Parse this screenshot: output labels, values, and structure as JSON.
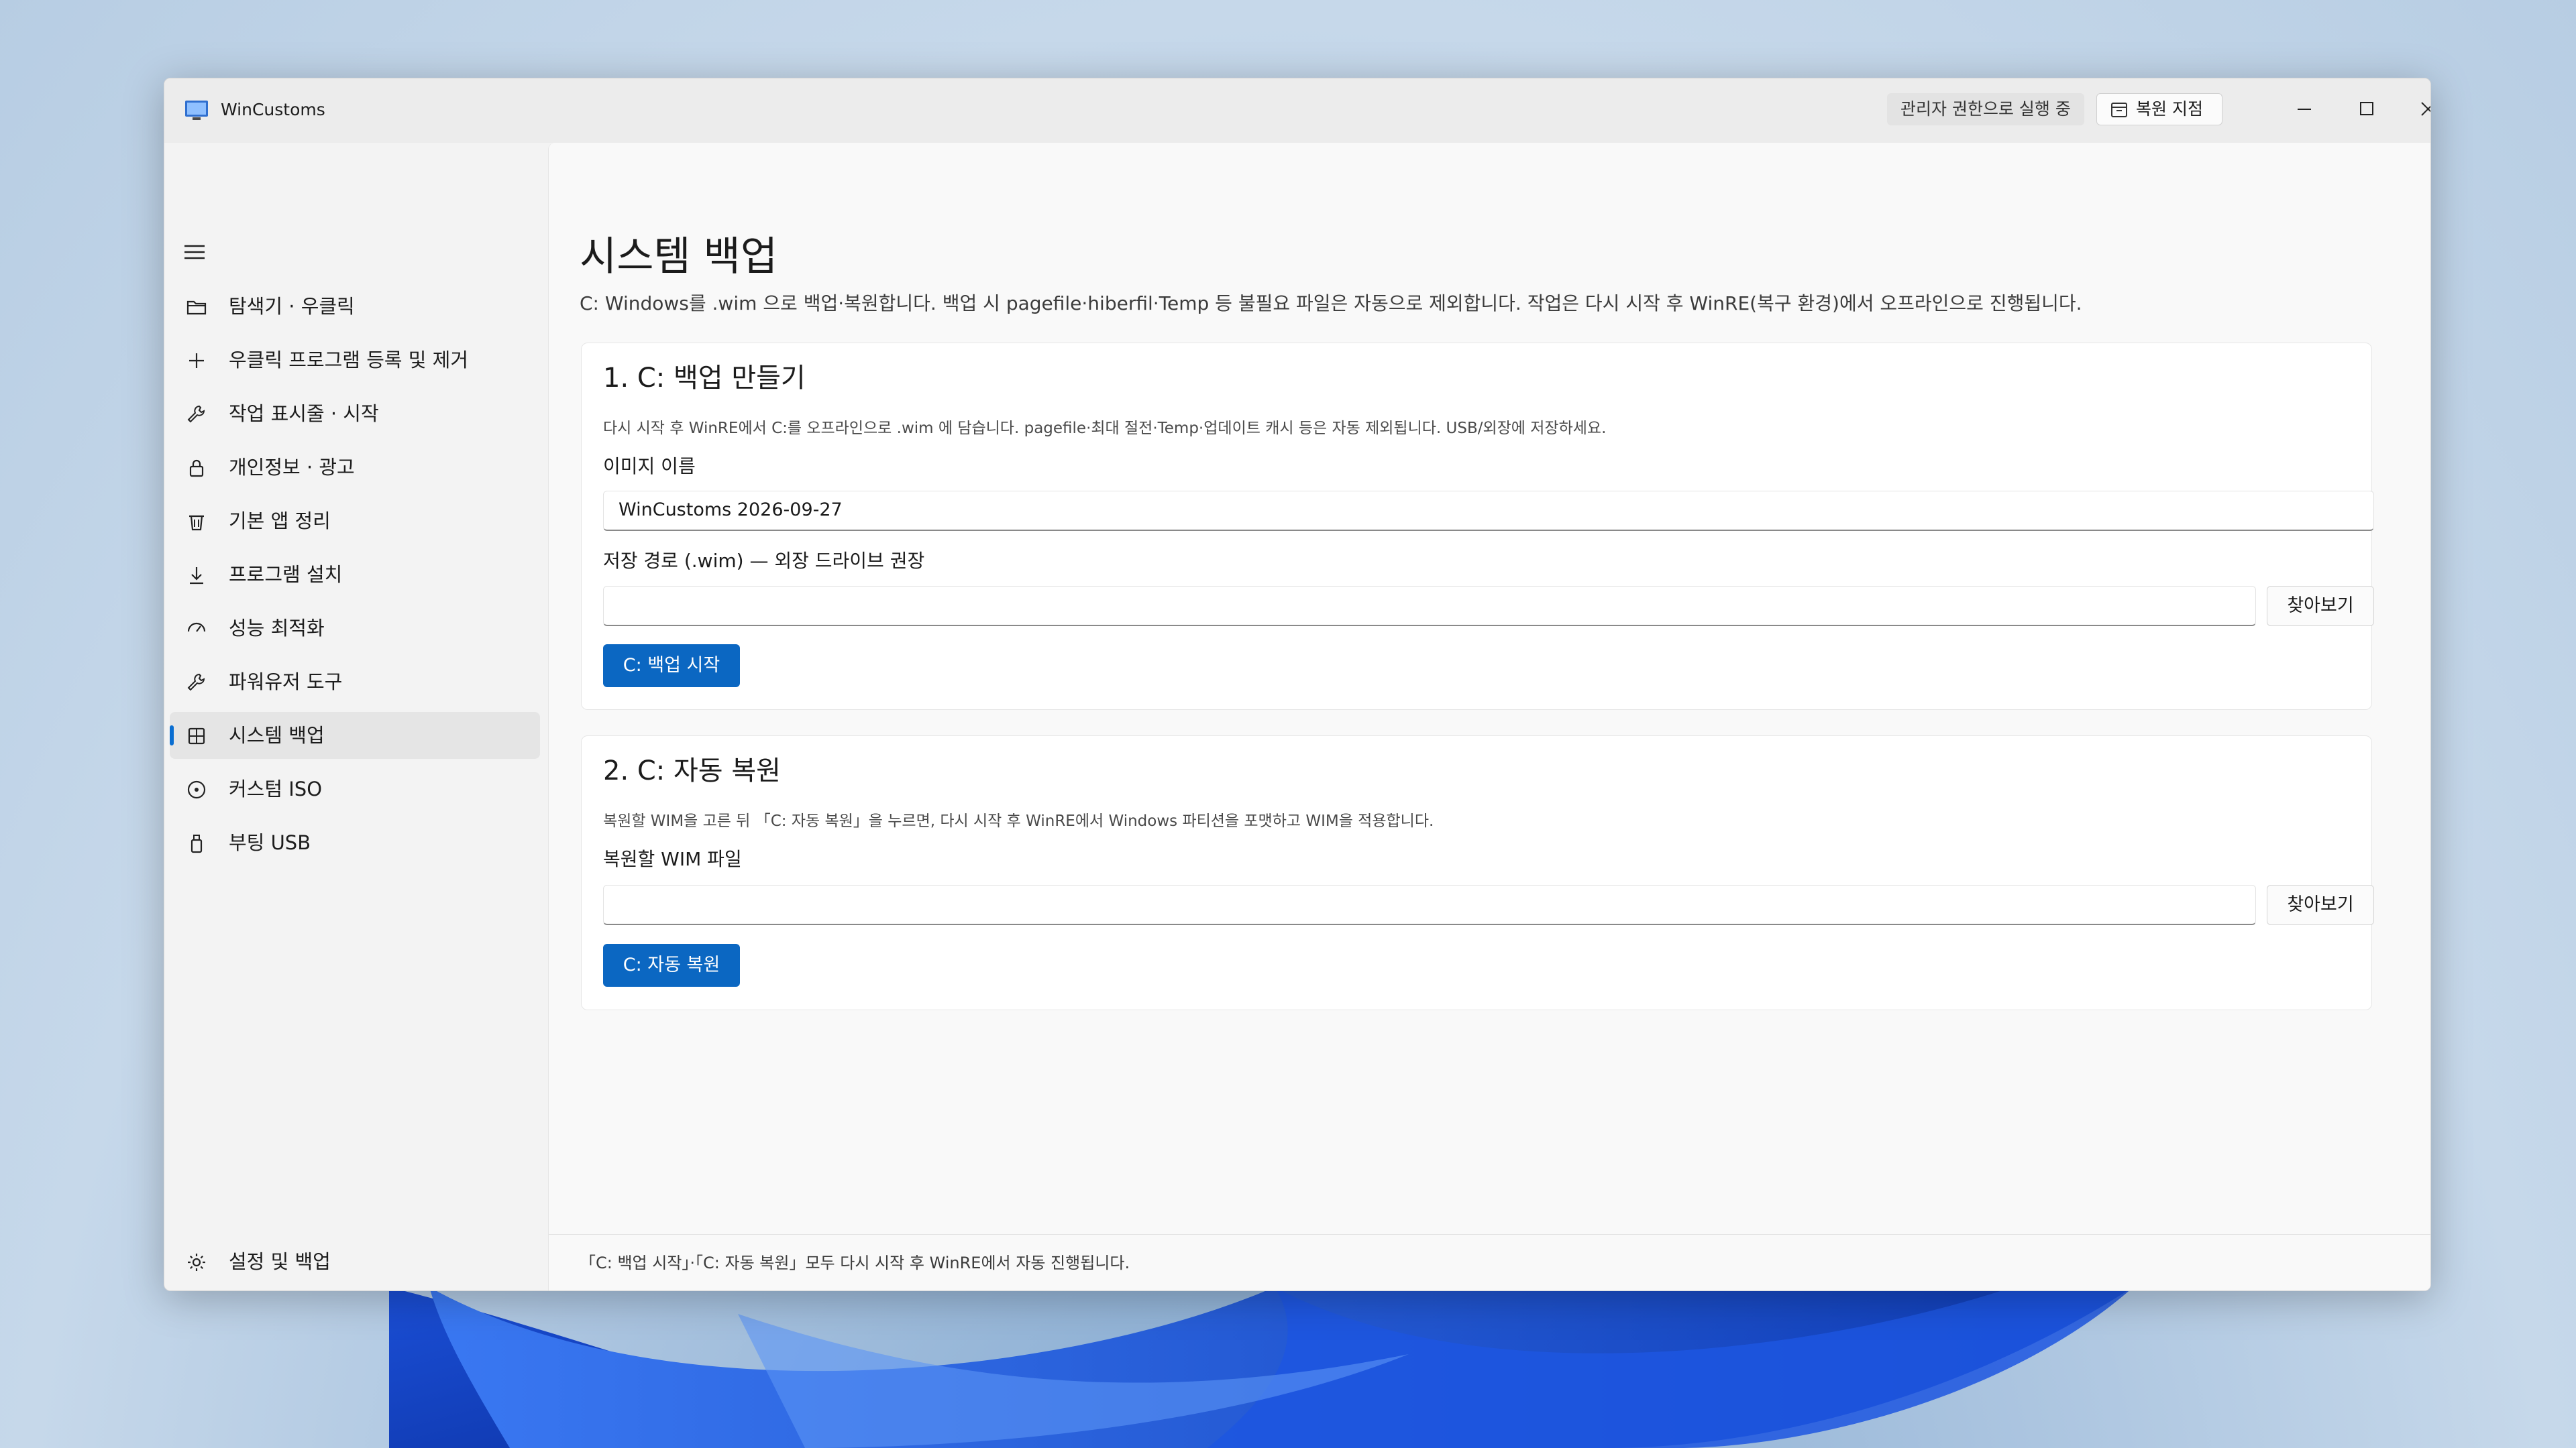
{
  "window": {
    "app_title": "WinCustoms",
    "admin_badge": "관리자 권한으로 실행 중",
    "restore_point_label": "복원 지점"
  },
  "sidebar": {
    "items": [
      {
        "label": "탐색기 · 우클릭",
        "icon": "folder-icon"
      },
      {
        "label": "우클릭 프로그램 등록 및 제거",
        "icon": "plus-icon"
      },
      {
        "label": "작업 표시줄 · 시작",
        "icon": "wrench-icon"
      },
      {
        "label": "개인정보 · 광고",
        "icon": "lock-icon"
      },
      {
        "label": "기본 앱 정리",
        "icon": "trash-icon"
      },
      {
        "label": "프로그램 설치",
        "icon": "download-icon"
      },
      {
        "label": "성능 최적화",
        "icon": "gauge-icon"
      },
      {
        "label": "파워유저 도구",
        "icon": "wrench-icon"
      },
      {
        "label": "시스템 백업",
        "icon": "backup-grid-icon",
        "active": true
      },
      {
        "label": "커스텀 ISO",
        "icon": "disc-icon"
      },
      {
        "label": "부팅 USB",
        "icon": "usb-icon"
      }
    ],
    "settings_label": "설정 및 백업"
  },
  "page": {
    "title": "시스템 백업",
    "description": "C: Windows를 .wim 으로 백업·복원합니다. 백업 시 pagefile·hiberfil·Temp 등 불필요 파일은 자동으로 제외합니다. 작업은 다시 시작 후 WinRE(복구 환경)에서 오프라인으로 진행됩니다."
  },
  "backup_card": {
    "title": "1. C: 백업 만들기",
    "description": "다시 시작 후 WinRE에서 C:를 오프라인으로 .wim 에 담습니다. pagefile·최대 절전·Temp·업데이트 캐시 등은 자동 제외됩니다. USB/외장에 저장하세요.",
    "image_name_label": "이미지 이름",
    "image_name_value": "WinCustoms 2026-09-27",
    "path_label": "저장 경로 (.wim) — 외장 드라이브 권장",
    "path_value": "",
    "browse_label": "찾아보기",
    "start_label": "C: 백업 시작"
  },
  "restore_card": {
    "title": "2. C: 자동 복원",
    "description": "복원할 WIM을 고른 뒤 「C: 자동 복원」을 누르면, 다시 시작 후 WinRE에서 Windows 파티션을 포맷하고 WIM을 적용합니다.",
    "wim_label": "복원할 WIM 파일",
    "wim_value": "",
    "browse_label": "찾아보기",
    "start_label": "C: 자동 복원"
  },
  "footer": {
    "text": "「C: 백업 시작」·「C: 자동 복원」모두 다시 시작 후 WinRE에서 자동 진행됩니다."
  },
  "colors": {
    "accent": "#0b67c2",
    "active_indicator": "#0a6ed1"
  }
}
